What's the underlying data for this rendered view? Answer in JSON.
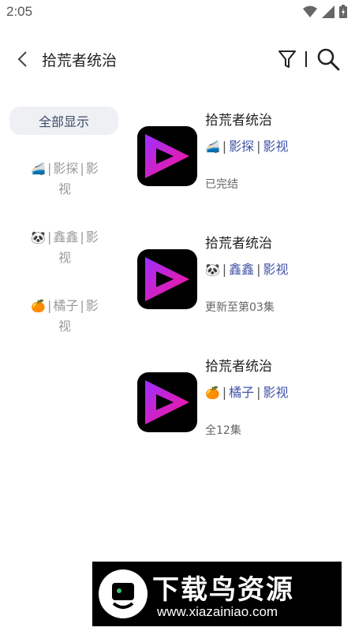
{
  "status_bar": {
    "time": "2:05",
    "icons": [
      "wifi-icon",
      "signal-icon",
      "battery-icon"
    ]
  },
  "app_bar": {
    "title": "拾荒者统治",
    "icons": [
      "back-icon",
      "filter-icon",
      "search-icon"
    ]
  },
  "sidebar": {
    "show_all_label": "全部显示",
    "sources": [
      {
        "emoji": "🚄",
        "name": "影探",
        "category": "影",
        "category2": "视"
      },
      {
        "emoji": "🐼",
        "name": "鑫鑫",
        "category": "影",
        "category2": "视"
      },
      {
        "emoji": "🍊",
        "name": "橘子",
        "category": "影",
        "category2": "视"
      }
    ]
  },
  "results": [
    {
      "title": "拾荒者统治",
      "emoji": "🚄",
      "source": "影探",
      "category": "影视",
      "status": "已完结"
    },
    {
      "title": "拾荒者统治",
      "emoji": "🐼",
      "source": "鑫鑫",
      "category": "影视",
      "status": "更新至第03集"
    },
    {
      "title": "拾荒者统治",
      "emoji": "🍊",
      "source": "橘子",
      "category": "影视",
      "status": "全12集"
    }
  ],
  "watermark": {
    "title": "下载鸟资源",
    "url": "www.xiazainiao.com"
  },
  "colors": {
    "accent": "#4253a6",
    "muted": "#9a9a9a",
    "cover_gradient_start": "#8a2be2",
    "cover_gradient_end": "#ff1493"
  }
}
